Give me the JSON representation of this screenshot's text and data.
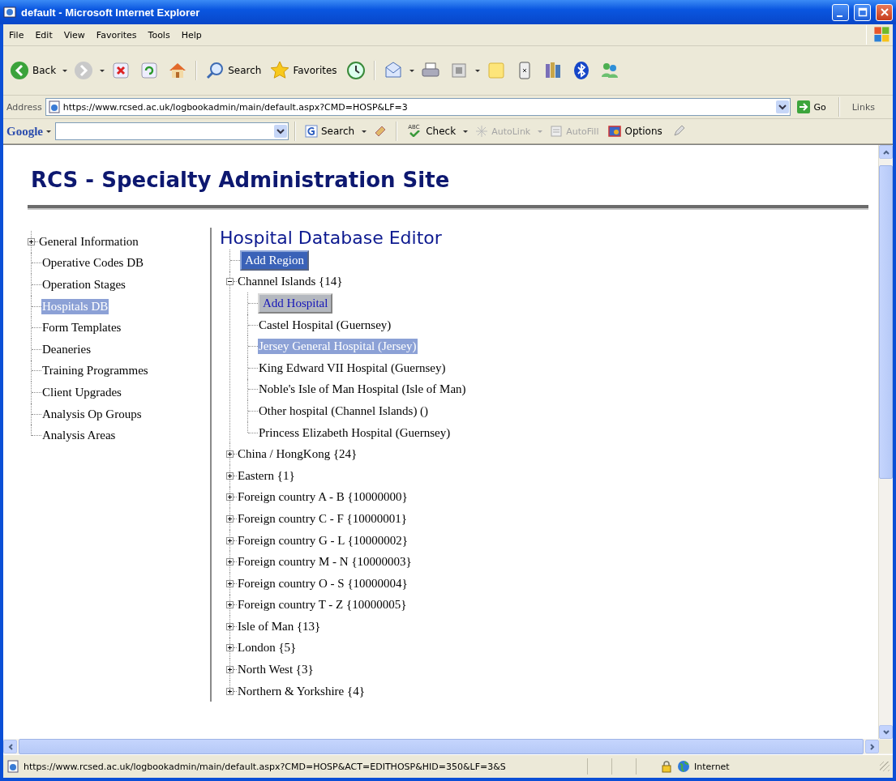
{
  "window": {
    "title": "default - Microsoft Internet Explorer"
  },
  "menu_bar": [
    "File",
    "Edit",
    "View",
    "Favorites",
    "Tools",
    "Help"
  ],
  "toolbar": {
    "back": "Back",
    "search": "Search",
    "favorites": "Favorites"
  },
  "address_bar": {
    "label": "Address",
    "value": "https://www.rcsed.ac.uk/logbookadmin/main/default.aspx?CMD=HOSP&LF=3",
    "go": "Go",
    "links": "Links"
  },
  "google_bar": {
    "logo": "Google",
    "search": "Search",
    "spell_mark": "ABC",
    "check": "Check",
    "autolink": "AutoLink",
    "autofill": "AutoFill",
    "options": "Options"
  },
  "page": {
    "site_title": "RCS - Specialty Administration Site",
    "nav": [
      {
        "label": "General Information",
        "kind": "branch",
        "expanded": false,
        "selected": false
      },
      {
        "label": "Operative Codes DB",
        "kind": "leaf",
        "selected": false
      },
      {
        "label": "Operation Stages",
        "kind": "leaf",
        "selected": false
      },
      {
        "label": "Hospitals DB",
        "kind": "leaf",
        "selected": true
      },
      {
        "label": "Form Templates",
        "kind": "leaf",
        "selected": false
      },
      {
        "label": "Deaneries",
        "kind": "leaf",
        "selected": false
      },
      {
        "label": "Training Programmes",
        "kind": "leaf",
        "selected": false
      },
      {
        "label": "Client Upgrades",
        "kind": "leaf",
        "selected": false
      },
      {
        "label": "Analysis Op Groups",
        "kind": "leaf",
        "selected": false
      },
      {
        "label": "Analysis Areas",
        "kind": "leaf",
        "selected": false
      }
    ],
    "editor": {
      "title": "Hospital Database Editor",
      "tree": [
        {
          "label": "Add Region",
          "kind": "button"
        },
        {
          "label": "Channel Islands {14}",
          "kind": "branch",
          "expanded": true,
          "children": [
            {
              "label": "Add Hospital",
              "kind": "button"
            },
            {
              "label": "Castel Hospital (Guernsey)",
              "kind": "leaf",
              "selected": false
            },
            {
              "label": "Jersey General Hospital (Jersey)",
              "kind": "leaf",
              "selected": true
            },
            {
              "label": "King Edward VII Hospital (Guernsey)",
              "kind": "leaf",
              "selected": false
            },
            {
              "label": "Noble's Isle of Man Hospital (Isle of Man)",
              "kind": "leaf",
              "selected": false
            },
            {
              "label": "Other hospital (Channel Islands) ()",
              "kind": "leaf",
              "selected": false
            },
            {
              "label": "Princess Elizabeth Hospital (Guernsey)",
              "kind": "leaf",
              "selected": false
            }
          ]
        },
        {
          "label": "China / HongKong {24}",
          "kind": "branch",
          "expanded": false
        },
        {
          "label": "Eastern {1}",
          "kind": "branch",
          "expanded": false
        },
        {
          "label": "Foreign country A - B {10000000}",
          "kind": "branch",
          "expanded": false
        },
        {
          "label": "Foreign country C - F {10000001}",
          "kind": "branch",
          "expanded": false
        },
        {
          "label": "Foreign country G - L {10000002}",
          "kind": "branch",
          "expanded": false
        },
        {
          "label": "Foreign country M - N {10000003}",
          "kind": "branch",
          "expanded": false
        },
        {
          "label": "Foreign country O - S {10000004}",
          "kind": "branch",
          "expanded": false
        },
        {
          "label": "Foreign country T - Z {10000005}",
          "kind": "branch",
          "expanded": false
        },
        {
          "label": "Isle of Man {13}",
          "kind": "branch",
          "expanded": false
        },
        {
          "label": "London {5}",
          "kind": "branch",
          "expanded": false
        },
        {
          "label": "North West {3}",
          "kind": "branch",
          "expanded": false
        },
        {
          "label": "Northern & Yorkshire {4}",
          "kind": "branch",
          "expanded": false
        }
      ]
    }
  },
  "status_bar": {
    "url": "https://www.rcsed.ac.uk/logbookadmin/main/default.aspx?CMD=HOSP&ACT=EDITHOSP&HID=350&LF=3&S",
    "zone": "Internet"
  }
}
